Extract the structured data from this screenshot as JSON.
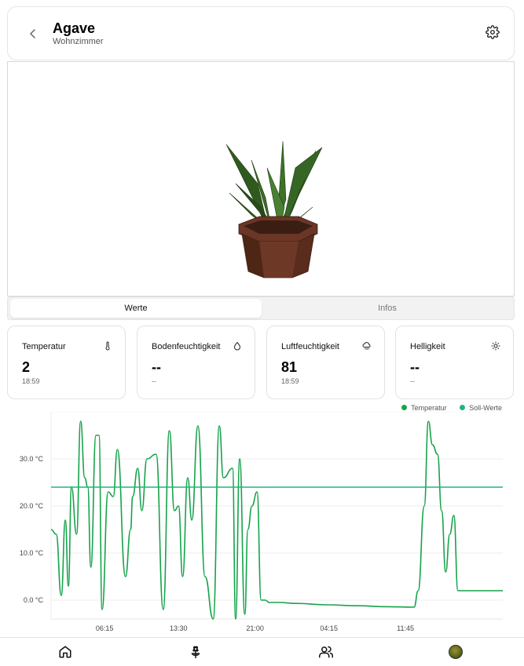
{
  "header": {
    "title": "Agave",
    "subtitle": "Wohnzimmer"
  },
  "tabs": [
    {
      "label": "Werte",
      "active": true
    },
    {
      "label": "Infos",
      "active": false
    }
  ],
  "cards": [
    {
      "label": "Temperatur",
      "icon": "thermometer-icon",
      "value": "2",
      "time": "18:59"
    },
    {
      "label": "Bodenfeuchtigkeit",
      "icon": "droplet-icon",
      "value": "--",
      "time": "--"
    },
    {
      "label": "Luftfeuchtigkeit",
      "icon": "cloud-drizzle-icon",
      "value": "81",
      "time": "18:59"
    },
    {
      "label": "Helligkeit",
      "icon": "sun-icon",
      "value": "--",
      "time": "--"
    }
  ],
  "legend": [
    {
      "label": "Temperatur",
      "color": "#16a34a"
    },
    {
      "label": "Soll-Werte",
      "color": "#1db584"
    }
  ],
  "chart_data": {
    "type": "line",
    "y_ticks": [
      "0.0 °C",
      "10.0 °C",
      "20.0 °C",
      "30.0 °C"
    ],
    "ylim": [
      -4,
      40
    ],
    "x_ticks": [
      "06:15",
      "13:30",
      "21:00",
      "04:15",
      "11:45"
    ],
    "x_tick_positions": [
      6.25,
      13.5,
      21.0,
      28.25,
      35.75
    ],
    "xlim": [
      1.0,
      45.3
    ],
    "series": [
      {
        "name": "Temperatur",
        "color": "#16a34a",
        "x": [
          1.0,
          1.5,
          2.0,
          2.4,
          2.7,
          3.0,
          3.5,
          3.9,
          4.3,
          4.6,
          4.9,
          5.4,
          5.7,
          6.0,
          6.6,
          7.1,
          7.5,
          8.3,
          8.8,
          9.0,
          9.5,
          9.9,
          10.4,
          11.3,
          12.0,
          12.6,
          13.1,
          13.5,
          13.9,
          14.4,
          14.8,
          15.4,
          16.1,
          16.9,
          17.5,
          17.9,
          18.8,
          19.1,
          19.5,
          20.0,
          20.3,
          20.7,
          21.2,
          21.6,
          22.0,
          22.4,
          22.7,
          23.3,
          25.0,
          28.0,
          31.0,
          34.0,
          36.6,
          37.0,
          37.6,
          38.0,
          38.4,
          38.9,
          39.3,
          39.7,
          40.1,
          40.5,
          40.9,
          41.3,
          41.7,
          42.1,
          42.6,
          43.0,
          43.5,
          43.9,
          44.3,
          44.7,
          45.0,
          45.3
        ],
        "y": [
          15,
          14,
          1,
          17,
          3,
          24,
          14,
          38,
          26,
          24,
          7,
          35,
          35,
          -2,
          23,
          22,
          32,
          5,
          15,
          22,
          28,
          19,
          30,
          31,
          -2,
          36,
          19,
          20,
          5,
          26,
          17,
          37,
          5,
          -4,
          37,
          26,
          28,
          -4,
          30,
          -3,
          15,
          20,
          23,
          0,
          0,
          -0.5,
          -0.5,
          -0.5,
          -0.7,
          -1.0,
          -1.2,
          -1.4,
          -1.5,
          2,
          20,
          38,
          33,
          31,
          19,
          6,
          14,
          18,
          2,
          2,
          2,
          2,
          2,
          2,
          2,
          2,
          2,
          2,
          2,
          2
        ],
        "note_trimmed_to_xlim": true
      },
      {
        "name": "Soll-Werte",
        "color": "#1db584",
        "x": [
          1.0,
          45.3
        ],
        "y": [
          24,
          24
        ]
      }
    ]
  }
}
